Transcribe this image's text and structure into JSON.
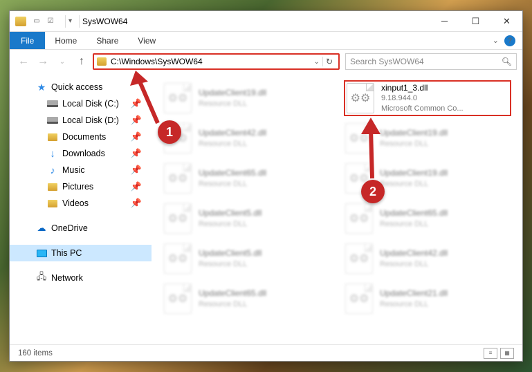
{
  "window": {
    "title": "SysWOW64"
  },
  "ribbon": {
    "file": "File",
    "tabs": [
      "Home",
      "Share",
      "View"
    ]
  },
  "nav": {
    "path": "C:\\Windows\\SysWOW64",
    "search_placeholder": "Search SysWOW64"
  },
  "sidebar": {
    "quick_access": {
      "label": "Quick access",
      "items": [
        {
          "label": "Local Disk (C:)",
          "type": "drive"
        },
        {
          "label": "Local Disk (D:)",
          "type": "drive"
        },
        {
          "label": "Documents",
          "type": "folder"
        },
        {
          "label": "Downloads",
          "type": "download"
        },
        {
          "label": "Music",
          "type": "music"
        },
        {
          "label": "Pictures",
          "type": "folder"
        },
        {
          "label": "Videos",
          "type": "folder"
        }
      ]
    },
    "onedrive": "OneDrive",
    "thispc": "This PC",
    "network": "Network"
  },
  "highlighted_file": {
    "name": "xinput1_3.dll",
    "version": "9.18.944.0",
    "description": "Microsoft Common Co..."
  },
  "blurred_files": [
    {
      "name": "UpdateClient19.dll",
      "sub": "Resource DLL"
    },
    {
      "name": "UpdateClient42.dll",
      "sub": "Resource DLL"
    },
    {
      "name": "UpdateClient19.dll",
      "sub": "Resource DLL"
    },
    {
      "name": "UpdateClient65.dll",
      "sub": "Resource DLL"
    },
    {
      "name": "UpdateClient19.dll",
      "sub": "Resource DLL"
    },
    {
      "name": "UpdateClient5.dll",
      "sub": "Resource DLL"
    },
    {
      "name": "UpdateClient65.dll",
      "sub": "Resource DLL"
    },
    {
      "name": "UpdateClient5.dll",
      "sub": "Resource DLL"
    },
    {
      "name": "UpdateClient42.dll",
      "sub": "Resource DLL"
    },
    {
      "name": "UpdateClient65.dll",
      "sub": "Resource DLL"
    },
    {
      "name": "UpdateClient21.dll",
      "sub": "Resource DLL"
    }
  ],
  "status": {
    "count": "160 items"
  },
  "callouts": {
    "one": "1",
    "two": "2"
  }
}
